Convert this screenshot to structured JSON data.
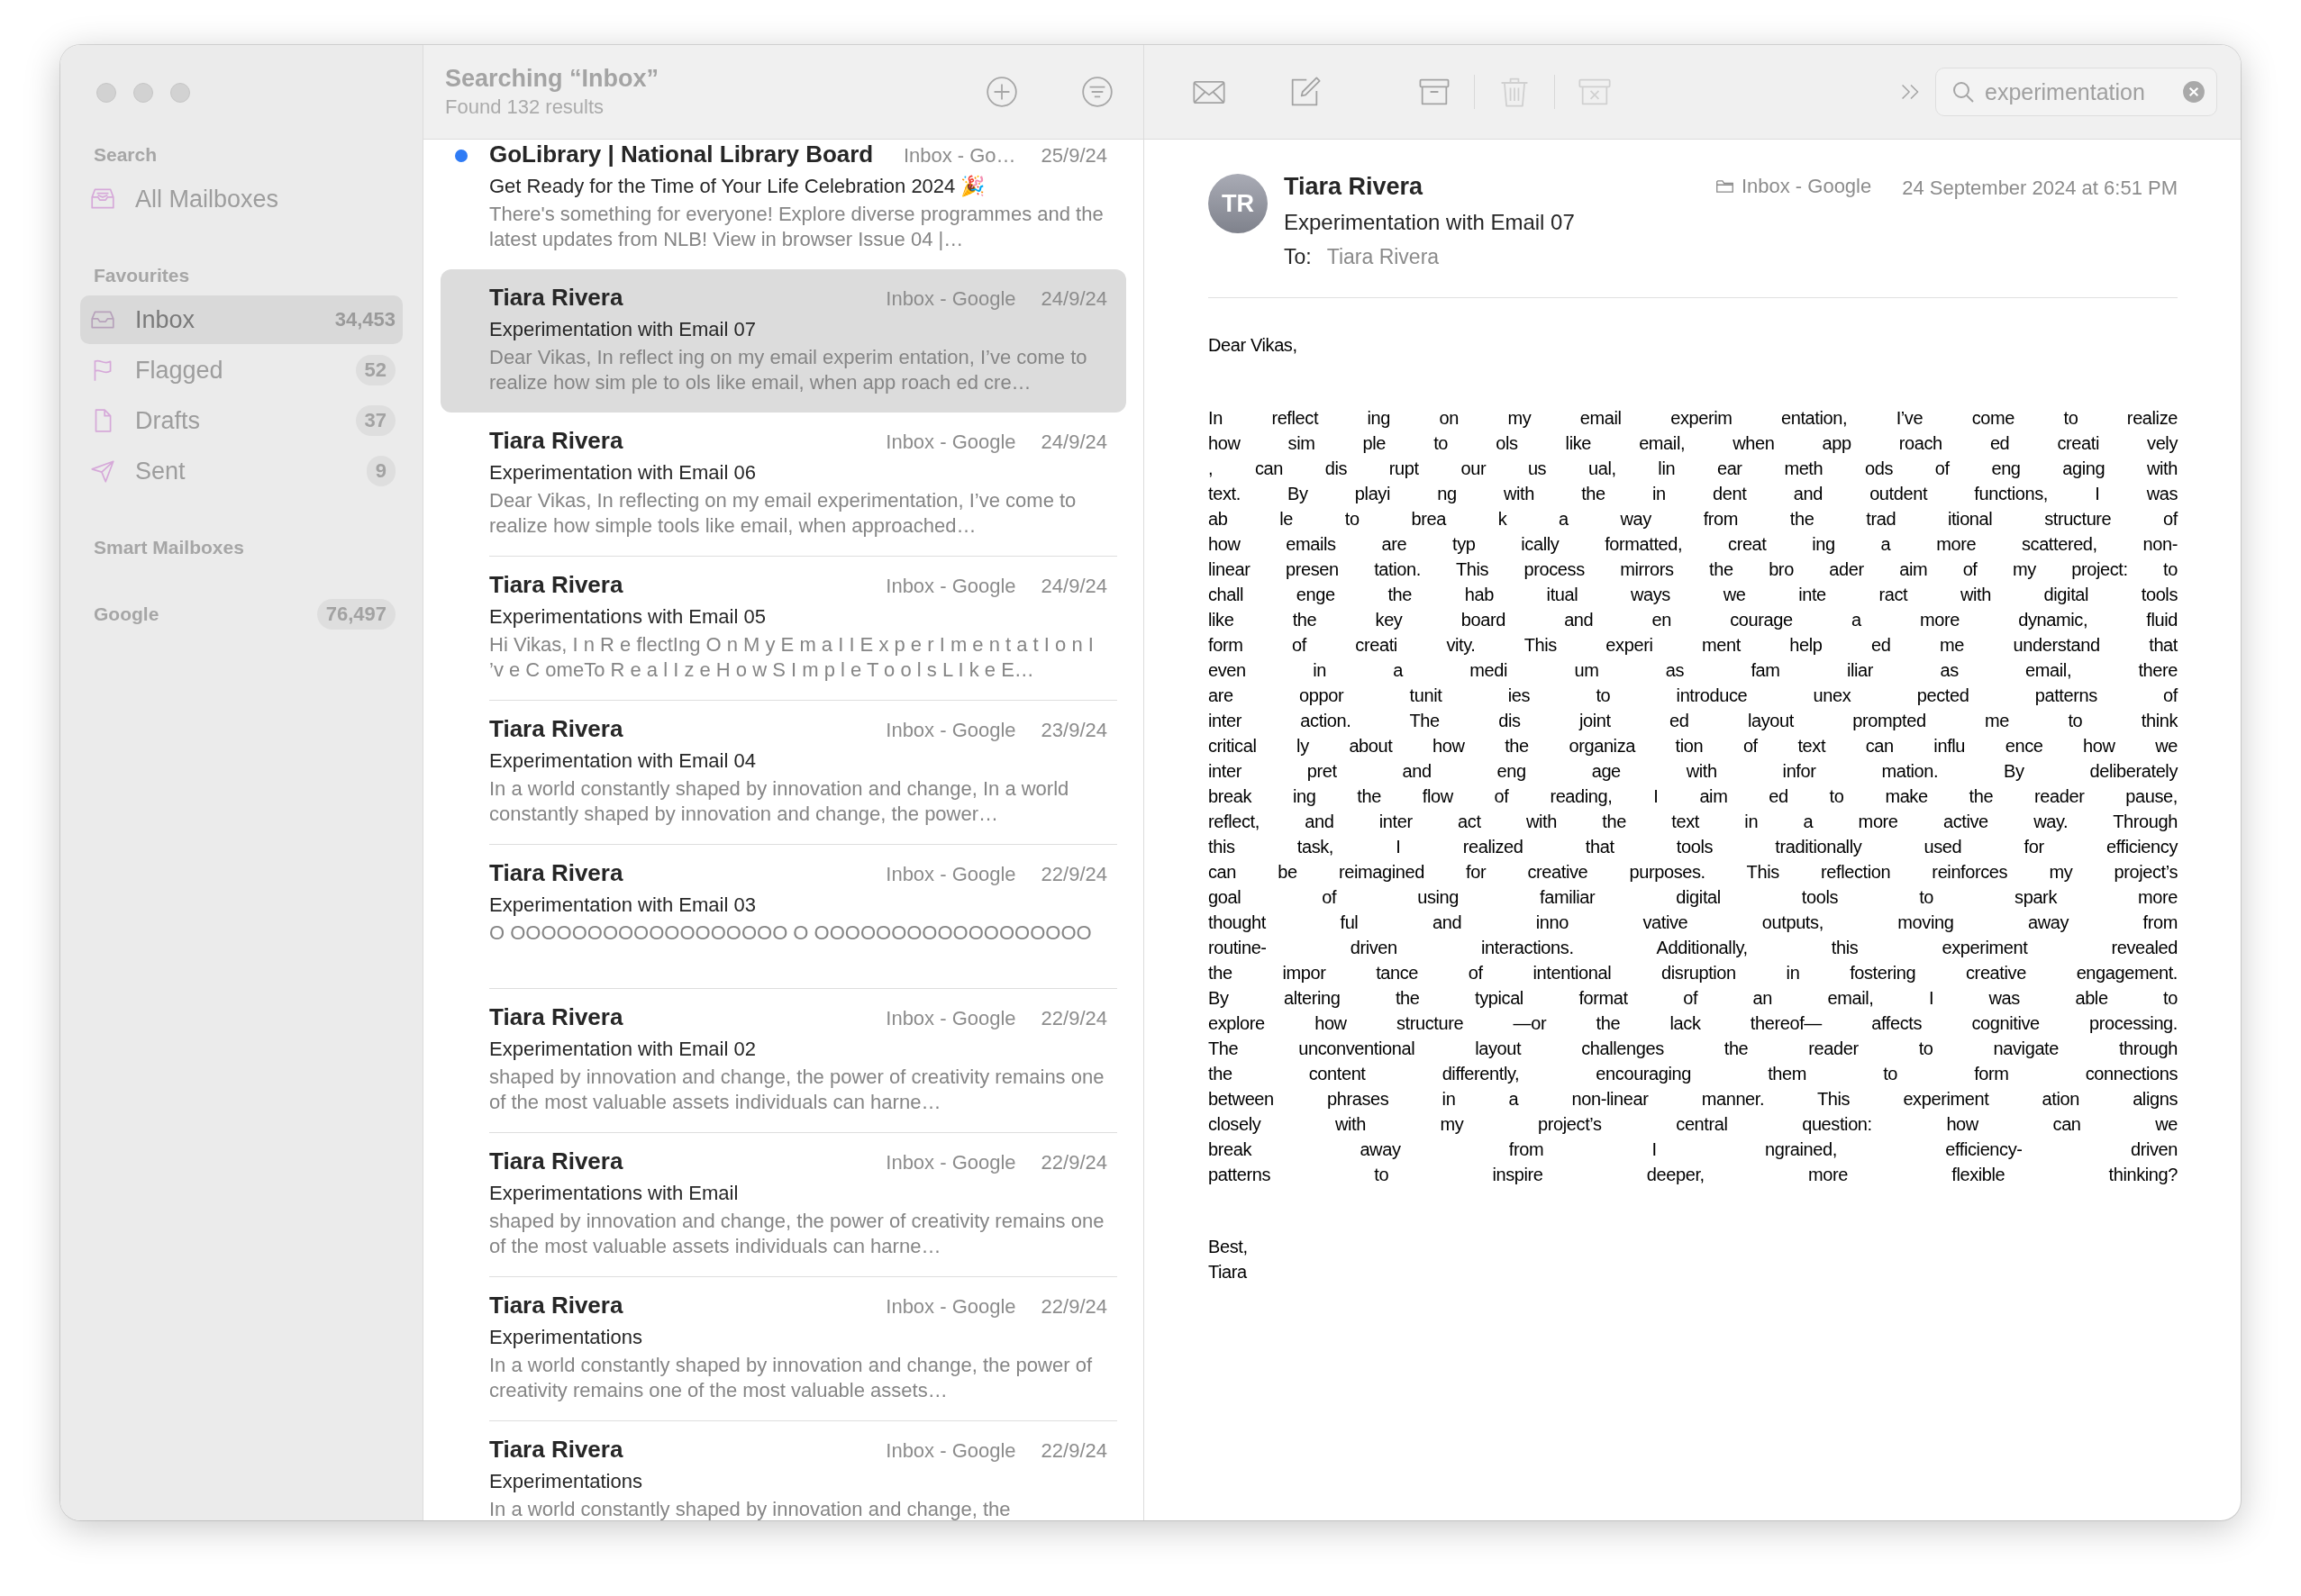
{
  "sidebar": {
    "sections": [
      {
        "heading": "Search",
        "items": [
          {
            "kind": "all_mailboxes",
            "label": "All Mailboxes",
            "selected": false
          }
        ]
      },
      {
        "heading": "Favourites",
        "items": [
          {
            "kind": "inbox",
            "label": "Inbox",
            "count": "34,453",
            "selected": true
          },
          {
            "kind": "flagged",
            "label": "Flagged",
            "count": "52",
            "selected": false
          },
          {
            "kind": "drafts",
            "label": "Drafts",
            "count": "37",
            "selected": false
          },
          {
            "kind": "sent",
            "label": "Sent",
            "count": "9",
            "selected": false
          }
        ]
      },
      {
        "heading": "Smart Mailboxes"
      },
      {
        "heading": "Google",
        "count": "76,497"
      }
    ]
  },
  "message_list": {
    "title": "Searching “Inbox”",
    "subtitle": "Found 132 results",
    "messages": [
      {
        "sender": "GoLibrary | National Library Board",
        "mailbox": "Inbox - Go…",
        "date": "25/9/24",
        "subject": "Get Ready for the Time of Your Life Celebration 2024 🎉",
        "preview": "There's something for everyone! Explore diverse programmes and the latest updates from NLB! View in browser Issue 04 |…",
        "unread": true,
        "selected": false
      },
      {
        "sender": "Tiara Rivera",
        "mailbox": "Inbox - Google",
        "date": "24/9/24",
        "subject": "Experimentation with Email 07",
        "preview": "Dear Vikas, In reflect ing on my email experim entation, I’ve come to realize how sim ple to ols like email, when app roach ed cre…",
        "unread": false,
        "selected": true
      },
      {
        "sender": "Tiara Rivera",
        "mailbox": "Inbox - Google",
        "date": "24/9/24",
        "subject": "Experimentation with Email 06",
        "preview": "Dear Vikas, In reflecting on my email experimentation, I’ve come to realize how simple tools like email, when approached…",
        "unread": false,
        "selected": false
      },
      {
        "sender": "Tiara Rivera",
        "mailbox": "Inbox - Google",
        "date": "24/9/24",
        "subject": "Experimentations with Email 05",
        "preview": "Hi Vikas, I n R e flectIng O n M y E m a I I E x p e r I m e n t a t I o n I ’v e C omeTo R e a l I z e H o w S I m p l e T o o l s L I k e E…",
        "unread": false,
        "selected": false
      },
      {
        "sender": "Tiara Rivera",
        "mailbox": "Inbox - Google",
        "date": "23/9/24",
        "subject": "Experimentation with Email 04",
        "preview": "In a world constantly shaped by innovation and change, In a world constantly shaped by innovation and change, the power…",
        "unread": false,
        "selected": false
      },
      {
        "sender": "Tiara Rivera",
        "mailbox": "Inbox - Google",
        "date": "22/9/24",
        "subject": "Experimentation with Email 03",
        "preview": "O OOOOOOOOOOOOOOOOOO O OOOOOOOOOOOOOOOOOO",
        "unread": false,
        "selected": false
      },
      {
        "sender": "Tiara Rivera",
        "mailbox": "Inbox - Google",
        "date": "22/9/24",
        "subject": "Experimentation with Email 02",
        "preview": "shaped by innovation and change, the power of creativity remains one of the most valuable assets individuals can harne…",
        "unread": false,
        "selected": false
      },
      {
        "sender": "Tiara Rivera",
        "mailbox": "Inbox - Google",
        "date": "22/9/24",
        "subject": "Experimentations with Email",
        "preview": "shaped by innovation and change, the power of creativity remains one of the most valuable assets individuals can harne…",
        "unread": false,
        "selected": false
      },
      {
        "sender": "Tiara Rivera",
        "mailbox": "Inbox - Google",
        "date": "22/9/24",
        "subject": "Experimentations",
        "preview": "In a world constantly shaped by innovation and change, the power of creativity remains one of the most valuable assets…",
        "unread": false,
        "selected": false
      },
      {
        "sender": "Tiara Rivera",
        "mailbox": "Inbox - Google",
        "date": "22/9/24",
        "subject": "Experimentations",
        "preview": "In a world constantly shaped by innovation and change, the",
        "unread": false,
        "selected": false
      }
    ]
  },
  "toolbar": {
    "buttons": [
      {
        "kind": "mail",
        "disabled": false
      },
      {
        "kind": "compose",
        "disabled": false
      },
      {
        "kind": "archive",
        "disabled": false
      },
      {
        "kind": "trash",
        "disabled": true
      },
      {
        "kind": "junk",
        "disabled": true
      },
      {
        "kind": "more",
        "disabled": false
      }
    ],
    "search": {
      "value": "experimentation"
    }
  },
  "reader": {
    "avatar": "TR",
    "sender": "Tiara Rivera",
    "subject": "Experimentation with Email 07",
    "to_label": "To:",
    "to": "Tiara Rivera",
    "mailbox": "Inbox - Google",
    "date": "24 September 2024 at 6:51 PM",
    "greeting": "Dear Vikas,",
    "lines": [
      "In reflect ing on my email experim entation, I’ve come to realize",
      "how sim ple to ols like email, when app roach ed creati vely",
      ", can dis rupt our us ual, lin ear meth ods of eng aging with",
      "text. By playi ng with the in dent and outdent functions, I was",
      "ab le to brea k a way from the trad itional structure of",
      "how emails are typ ically formatted, creat ing a more scattered, non-",
      "linear presen tation. This process mirrors the bro ader aim of my project: to",
      "chall enge the hab itual ways we inte ract with digital tools",
      "like the key board and en courage a more dynamic, fluid",
      "form of creati vity. This experi ment help ed me understand that",
      "even in a medi um as fam iliar as email, there",
      "are oppor tunit ies to introduce unex pected patterns of",
      "inter action. The dis joint ed layout prompted me to think",
      "critical ly about how the organiza tion of text can influ ence how we",
      "inter pret and eng age with infor mation. By deliberately",
      "break ing the flow of reading, I aim ed to make the reader pause,",
      "reflect, and inter act with the text in a more active way. Through",
      "this task, I realized that tools traditionally used for efficiency",
      "can be reimagined for creative purposes. This reflection reinforces my project’s",
      "goal of using familiar digital tools to spark more",
      "thought ful and inno vative outputs, moving away from",
      "routine- driven interactions. Additionally, this experiment revealed",
      "the impor tance of intentional disruption in fostering creative engagement.",
      "By altering the typical format of an email, I was able to",
      "explore how structure —or the lack thereof— affects cognitive processing.",
      "The unconventional layout challenges the reader to navigate through",
      "the content differently, encouraging them to form connections",
      "between phrases in a non-linear manner. This experiment ation aligns",
      "closely with my project’s central question: how can we",
      "break away from I ngrained, efficiency- driven",
      "patterns to inspire deeper, more flexible thinking?"
    ],
    "closing": [
      "Best,",
      "Tiara"
    ]
  }
}
